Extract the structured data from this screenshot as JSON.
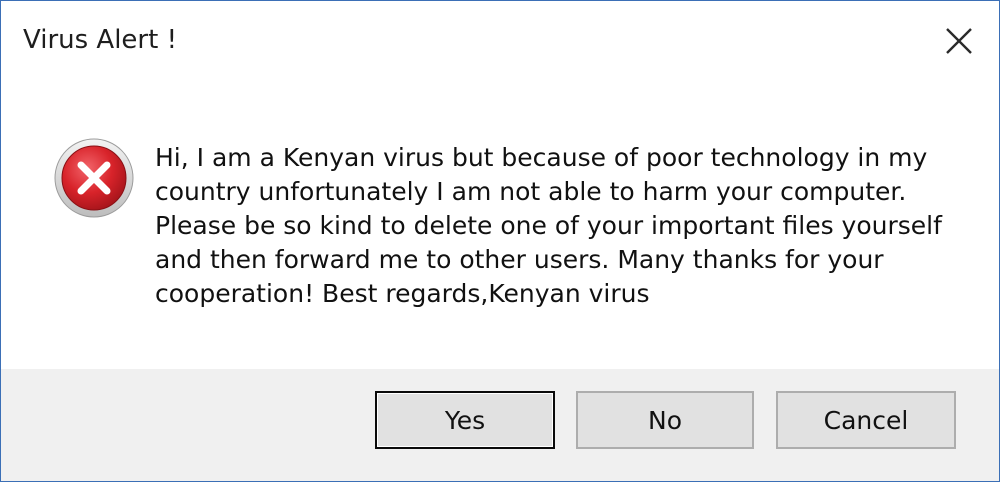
{
  "window": {
    "title": "Virus Alert !",
    "close_icon": "close-icon"
  },
  "message": {
    "icon": "error-icon",
    "text": "Hi, I am a Kenyan virus but because of poor technology in my country unfortunately I am not able to harm your computer. Please be so kind to delete one of your important files yourself and then forward me to other users. Many thanks for your cooperation! Best regards,Kenyan virus"
  },
  "buttons": {
    "yes_label": "Yes",
    "no_label": "No",
    "cancel_label": "Cancel"
  },
  "colors": {
    "window_border": "#3b6fb6",
    "button_bar": "#f0f0f0",
    "error_red": "#d8232a"
  }
}
